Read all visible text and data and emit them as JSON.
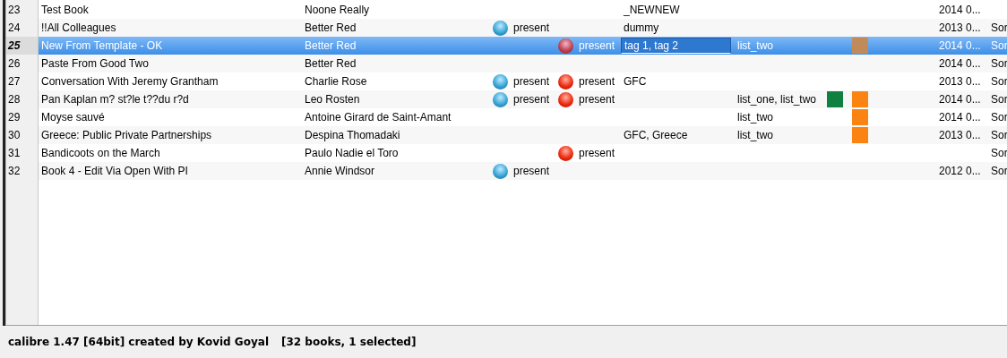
{
  "rows": [
    {
      "number": "23",
      "title": "Test Book",
      "author": "Noone Really",
      "column_5": "_NEWNEW",
      "column_10": "2014 0...",
      "selected": false,
      "editing": false
    },
    {
      "number": "24",
      "title": "!!All Colleagues",
      "author": "Better Red",
      "column_3": "present",
      "column_5": "dummy",
      "column_10": "2013 0...",
      "column_11": "Sor",
      "selected": false,
      "editing": false
    },
    {
      "number": "25",
      "title": "New From Template - OK",
      "author": "Better Red",
      "column_4": "present",
      "column_5": "tag 1, tag 2",
      "column_6": "list_two",
      "column_8": {
        "color": "#c08a5a"
      },
      "column_10": "2014 0...",
      "column_11": "Sor",
      "selected": true,
      "editing": true
    },
    {
      "number": "26",
      "title": "Paste From Good Two",
      "author": "Better Red",
      "column_10": "2014 0...",
      "column_11": "Sor",
      "selected": false,
      "editing": false
    },
    {
      "number": "27",
      "title": "Conversation With Jeremy Grantham",
      "author": "Charlie Rose",
      "column_3": "present",
      "column_4": "present",
      "column_5": "GFC",
      "column_10": "2013 0...",
      "column_11": "Sor",
      "selected": false,
      "editing": false
    },
    {
      "number": "28",
      "title": "Pan Kaplan m? st?le t??du r?d",
      "author": "Leo Rosten",
      "column_3": "present",
      "column_4": "present",
      "column_6": "list_one, list_two",
      "column_7": {
        "color": "#0f8040"
      },
      "column_8": {
        "color": "#fb8311"
      },
      "column_10": "2014 0...",
      "column_11": "Sor",
      "selected": false,
      "editing": false
    },
    {
      "number": "29",
      "title": "Moyse sauvé",
      "author": "Antoine Girard de Saint-Amant",
      "column_6": "list_two",
      "column_8": {
        "color": "#fb8311"
      },
      "column_10": "2014 0...",
      "column_11": "Sor",
      "selected": false,
      "editing": false
    },
    {
      "number": "30",
      "title": "Greece: Public Private Partnerships",
      "author": "Despina Thomadaki",
      "column_5": "GFC, Greece",
      "column_6": "list_two",
      "column_8": {
        "color": "#fb8311"
      },
      "column_10": "2013 0...",
      "column_11": "Sor",
      "selected": false,
      "editing": false
    },
    {
      "number": "31",
      "title": "Bandicoots on the March",
      "author": "Paulo Nadie el Toro",
      "column_4": "present",
      "column_11": "Sor",
      "selected": false,
      "editing": false
    },
    {
      "number": "32",
      "title": "Book 4 - Edit Via Open With PI",
      "author": "Annie Windsor",
      "column_3": "present",
      "column_10": "2012 0...",
      "column_11": "Sor",
      "selected": false,
      "editing": false
    }
  ],
  "status_bar": {
    "version": "calibre 1.47 [64bit] created by Kovid Goyal",
    "count": "[32 books, 1 selected]"
  }
}
